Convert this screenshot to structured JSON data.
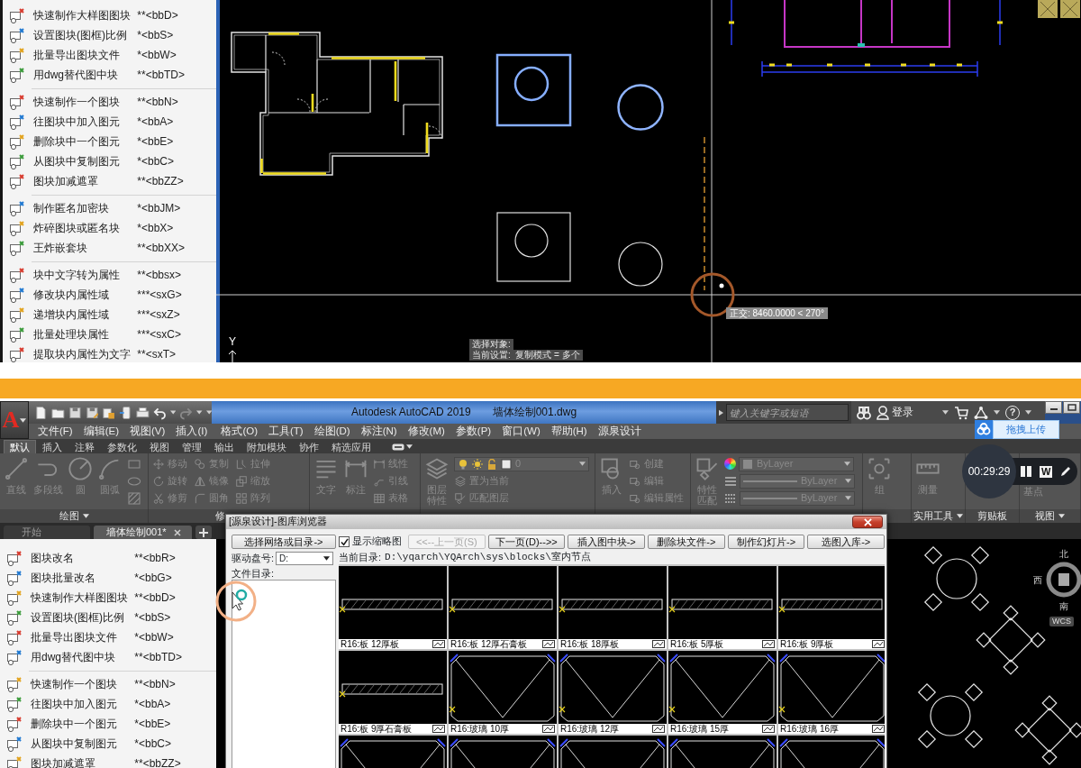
{
  "top_screen": {
    "menu_groups": [
      [
        {
          "label": "快速制作大样图图块",
          "shortcut": "**<bbD>"
        },
        {
          "label": "设置图块(图框)比例",
          "shortcut": "*<bbS>"
        },
        {
          "label": "批量导出图块文件",
          "shortcut": "*<bbW>"
        },
        {
          "label": "用dwg替代图中块",
          "shortcut": "**<bbTD>"
        }
      ],
      [
        {
          "label": "快速制作一个图块",
          "shortcut": "**<bbN>"
        },
        {
          "label": "往图块中加入图元",
          "shortcut": "*<bbA>"
        },
        {
          "label": "删除块中一个图元",
          "shortcut": "*<bbE>"
        },
        {
          "label": "从图块中复制图元",
          "shortcut": "*<bbC>"
        },
        {
          "label": "图块加减遮罩",
          "shortcut": "**<bbZZ>"
        }
      ],
      [
        {
          "label": "制作匿名加密块",
          "shortcut": "*<bbJM>"
        },
        {
          "label": "炸碎图块或匿名块",
          "shortcut": "*<bbX>"
        },
        {
          "label": "王炸嵌套块",
          "shortcut": "**<bbXX>"
        }
      ],
      [
        {
          "label": "块中文字转为属性",
          "shortcut": "**<bbsx>"
        },
        {
          "label": "修改块内属性域",
          "shortcut": "***<sxG>"
        },
        {
          "label": "递增块内属性域",
          "shortcut": "***<sxZ>"
        },
        {
          "label": "批量处理块属性",
          "shortcut": "***<sxC>"
        },
        {
          "label": "提取块内属性为文字",
          "shortcut": "**<sxT>"
        }
      ]
    ],
    "canvas": {
      "tooltip": "正交: 8460.0000 < 270°",
      "command_lines": [
        "选择对象:",
        "当前设置:  复制模式 = 多个"
      ],
      "axis_label": "Y"
    }
  },
  "bottom_screen": {
    "title_bar": {
      "app_logo": "A",
      "app_title": "Autodesk AutoCAD 2019",
      "file_name": "墙体绘制001.dwg",
      "search_placeholder": "键入关键字或短语",
      "sign_in": "登录",
      "help": "?"
    },
    "menu_bar": [
      "文件(F)",
      "编辑(E)",
      "视图(V)",
      "插入(I)",
      "格式(O)",
      "工具(T)",
      "绘图(D)",
      "标注(N)",
      "修改(M)",
      "参数(P)",
      "窗口(W)",
      "帮助(H)",
      "源泉设计"
    ],
    "ribbon_tabs": [
      {
        "label": "默认",
        "selected": true
      },
      {
        "label": "插入",
        "selected": false
      },
      {
        "label": "注释",
        "selected": false
      },
      {
        "label": "参数化",
        "selected": false
      },
      {
        "label": "视图",
        "selected": false
      },
      {
        "label": "管理",
        "selected": false
      },
      {
        "label": "输出",
        "selected": false
      },
      {
        "label": "附加模块",
        "selected": false
      },
      {
        "label": "协作",
        "selected": false
      },
      {
        "label": "精选应用",
        "selected": false
      }
    ],
    "ribbon_panels": [
      {
        "title": "绘图",
        "dropdown": true,
        "tools": [
          {
            "label": "直线",
            "kind": "large"
          },
          {
            "label": "多段线",
            "kind": "large"
          },
          {
            "label": "圆",
            "kind": "large"
          },
          {
            "label": "圆弧",
            "kind": "large"
          },
          {
            "kind": "icon"
          },
          {
            "kind": "icon"
          },
          {
            "kind": "icon"
          }
        ]
      },
      {
        "title": "修",
        "dropdown": false,
        "tools": [
          {
            "label": "移动",
            "kind": "small"
          },
          {
            "label": "旋转",
            "kind": "small"
          },
          {
            "label": "修剪",
            "kind": "small"
          },
          {
            "label": "复制",
            "kind": "small"
          },
          {
            "label": "镜像",
            "kind": "small"
          },
          {
            "label": "圆角",
            "kind": "small"
          },
          {
            "label": "拉伸",
            "kind": "small"
          },
          {
            "label": "缩放",
            "kind": "small"
          },
          {
            "label": "阵列",
            "kind": "small"
          }
        ]
      },
      {
        "tools": [
          {
            "label": "文字",
            "kind": "large"
          },
          {
            "label": "标注",
            "kind": "large"
          },
          {
            "label": "线性",
            "kind": "small"
          },
          {
            "label": "引线",
            "kind": "small"
          },
          {
            "label": "表格",
            "kind": "small"
          }
        ]
      },
      {
        "dropdowns": [
          {
            "value": "0",
            "kind": "layer"
          }
        ],
        "tools": [
          {
            "label": "图层特性",
            "kind": "large"
          },
          {
            "label": "置为当前",
            "kind": "small"
          },
          {
            "label": "匹配图层",
            "kind": "small"
          }
        ]
      },
      {
        "tools": [
          {
            "label": "插入",
            "kind": "large"
          },
          {
            "label": "创建",
            "kind": "small"
          },
          {
            "label": "编辑",
            "kind": "small"
          },
          {
            "label": "编辑属性",
            "kind": "small"
          }
        ]
      },
      {
        "dropdowns": [
          {
            "value": "ByLayer",
            "kind": "color"
          },
          {
            "value": "ByLayer",
            "kind": "linetype"
          },
          {
            "value": "ByLayer",
            "kind": "lineweight"
          }
        ],
        "tools": [
          {
            "label": "特性匹配",
            "kind": "large"
          }
        ]
      },
      {
        "tools": [
          {
            "label": "组",
            "kind": "large"
          }
        ]
      },
      {
        "title": "实用工具",
        "dropdown": true,
        "tools": [
          {
            "label": "测量",
            "kind": "large"
          }
        ]
      },
      {
        "title": "剪贴板",
        "dropdown": false
      },
      {
        "title": "视图",
        "dropdown": true,
        "tools": [
          {
            "label": "基点",
            "kind": "large"
          }
        ]
      }
    ],
    "document_tabs": [
      {
        "label": "开始",
        "selected": false
      },
      {
        "label": "墙体绘制001*",
        "selected": true
      }
    ],
    "menu_groups": [
      [
        {
          "label": "图块改名",
          "shortcut": "**<bbR>"
        },
        {
          "label": "图块批量改名",
          "shortcut": "*<bbG>"
        },
        {
          "label": "快速制作大样图图块",
          "shortcut": "**<bbD>"
        },
        {
          "label": "设置图块(图框)比例",
          "shortcut": "*<bbS>"
        },
        {
          "label": "批量导出图块文件",
          "shortcut": "*<bbW>"
        },
        {
          "label": "用dwg替代图中块",
          "shortcut": "**<bbTD>"
        }
      ],
      [
        {
          "label": "快速制作一个图块",
          "shortcut": "**<bbN>"
        },
        {
          "label": "往图块中加入图元",
          "shortcut": "*<bbA>"
        },
        {
          "label": "删除块中一个图元",
          "shortcut": "*<bbE>"
        },
        {
          "label": "从图块中复制图元",
          "shortcut": "*<bbC>"
        },
        {
          "label": "图块加减遮罩",
          "shortcut": "**<bbZZ>"
        }
      ]
    ],
    "dialog": {
      "title": "[源泉设计]-图库浏览器",
      "browse_button": "选择网络或目录->",
      "drive_label": "驱动盘号:",
      "drive_value": "D:",
      "directory_label": "文件目录:",
      "show_thumbnails": {
        "label": "显示缩略图",
        "checked": true
      },
      "buttons": [
        {
          "label": "<<--上一页(S)",
          "disabled": true
        },
        {
          "label": "下一页(D)-->>",
          "disabled": false
        },
        {
          "label": "插入图中块->",
          "disabled": false
        },
        {
          "label": "删除块文件->",
          "disabled": false
        },
        {
          "label": "制作幻灯片->",
          "disabled": false
        },
        {
          "label": "选图入库->",
          "disabled": false
        }
      ],
      "current_directory_label": "当前目录:",
      "current_directory": "D:\\yqarch\\YQArch\\sys\\blocks\\室内节点",
      "thumbnails": [
        {
          "caption": "R16:板 12厚板",
          "kind": "board"
        },
        {
          "caption": "R16:板 12厚石膏板",
          "kind": "board"
        },
        {
          "caption": "R16:板 18厚板",
          "kind": "board"
        },
        {
          "caption": "R16:板 5厚板",
          "kind": "board"
        },
        {
          "caption": "R16:板 9厚板",
          "kind": "board"
        },
        {
          "caption": "R16:板 9厚石膏板",
          "kind": "board"
        },
        {
          "caption": "R16:玻璃 10厚",
          "kind": "glass"
        },
        {
          "caption": "R16:玻璃 12厚",
          "kind": "glass"
        },
        {
          "caption": "R16:玻璃 15厚",
          "kind": "glass"
        },
        {
          "caption": "R16:玻璃 16厚",
          "kind": "glass"
        },
        {
          "kind": "glass"
        },
        {
          "kind": "glass"
        },
        {
          "kind": "glass"
        },
        {
          "kind": "glass"
        },
        {
          "kind": "glass"
        }
      ]
    },
    "upload_popup": {
      "label": "拖拽上传"
    },
    "recorder": {
      "time": "00:29:29",
      "badge": "W"
    },
    "view_cube": {
      "labels": [
        "北",
        "西",
        "南"
      ],
      "coordinate_system": "WCS"
    }
  }
}
